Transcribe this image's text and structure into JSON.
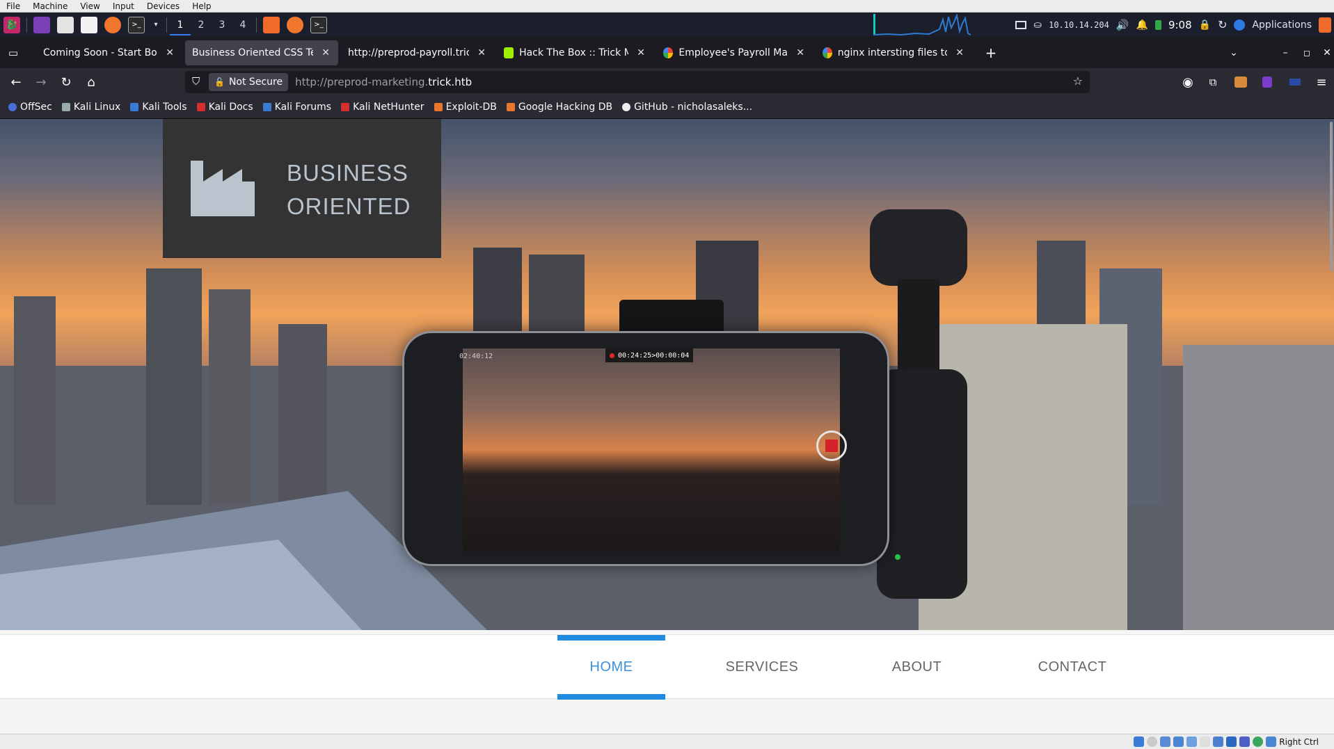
{
  "vbox_menu": [
    "File",
    "Machine",
    "View",
    "Input",
    "Devices",
    "Help"
  ],
  "kali_panel": {
    "workspaces": [
      "1",
      "2",
      "3",
      "4"
    ],
    "active_workspace": "1",
    "ip": "10.10.14.204",
    "clock": "9:08",
    "applications_label": "Applications"
  },
  "tabs": [
    {
      "title": "Coming Soon - Start Boot",
      "active": false
    },
    {
      "title": "Business Oriented CSS Temp",
      "active": true
    },
    {
      "title": "http://preprod-payroll.trick.h",
      "active": false
    },
    {
      "title": "Hack The Box :: Trick Mac",
      "active": false
    },
    {
      "title": "Employee's Payroll Mana",
      "active": false
    },
    {
      "title": "nginx intersting files to ch",
      "active": false
    }
  ],
  "tab_close_glyph": "✕",
  "new_tab_glyph": "+",
  "navbar": {
    "security_label": "Not Secure",
    "url_prefix": "http://preprod-marketing.",
    "url_domain": "trick.htb"
  },
  "bookmarks": [
    "OffSec",
    "Kali Linux",
    "Kali Tools",
    "Kali Docs",
    "Kali Forums",
    "Kali NetHunter",
    "Exploit-DB",
    "Google Hacking DB",
    "GitHub - nicholasaleks..."
  ],
  "page": {
    "logo_line1": "BUSINESS",
    "logo_line2": "ORIENTED",
    "phone_storage": "02:40:12",
    "phone_rec_time": "00:24:25>00:00:04",
    "menu": [
      {
        "label": "HOME",
        "active": true
      },
      {
        "label": "SERVICES",
        "active": false
      },
      {
        "label": "ABOUT",
        "active": false
      },
      {
        "label": "CONTACT",
        "active": false
      }
    ]
  },
  "vbox_status": {
    "host_key": "Right Ctrl"
  },
  "colors": {
    "accent": "#1f8ae0",
    "logo_bg": "#333333",
    "logo_text": "#b9c4cf",
    "firefox_bg": "#2b2a33"
  }
}
